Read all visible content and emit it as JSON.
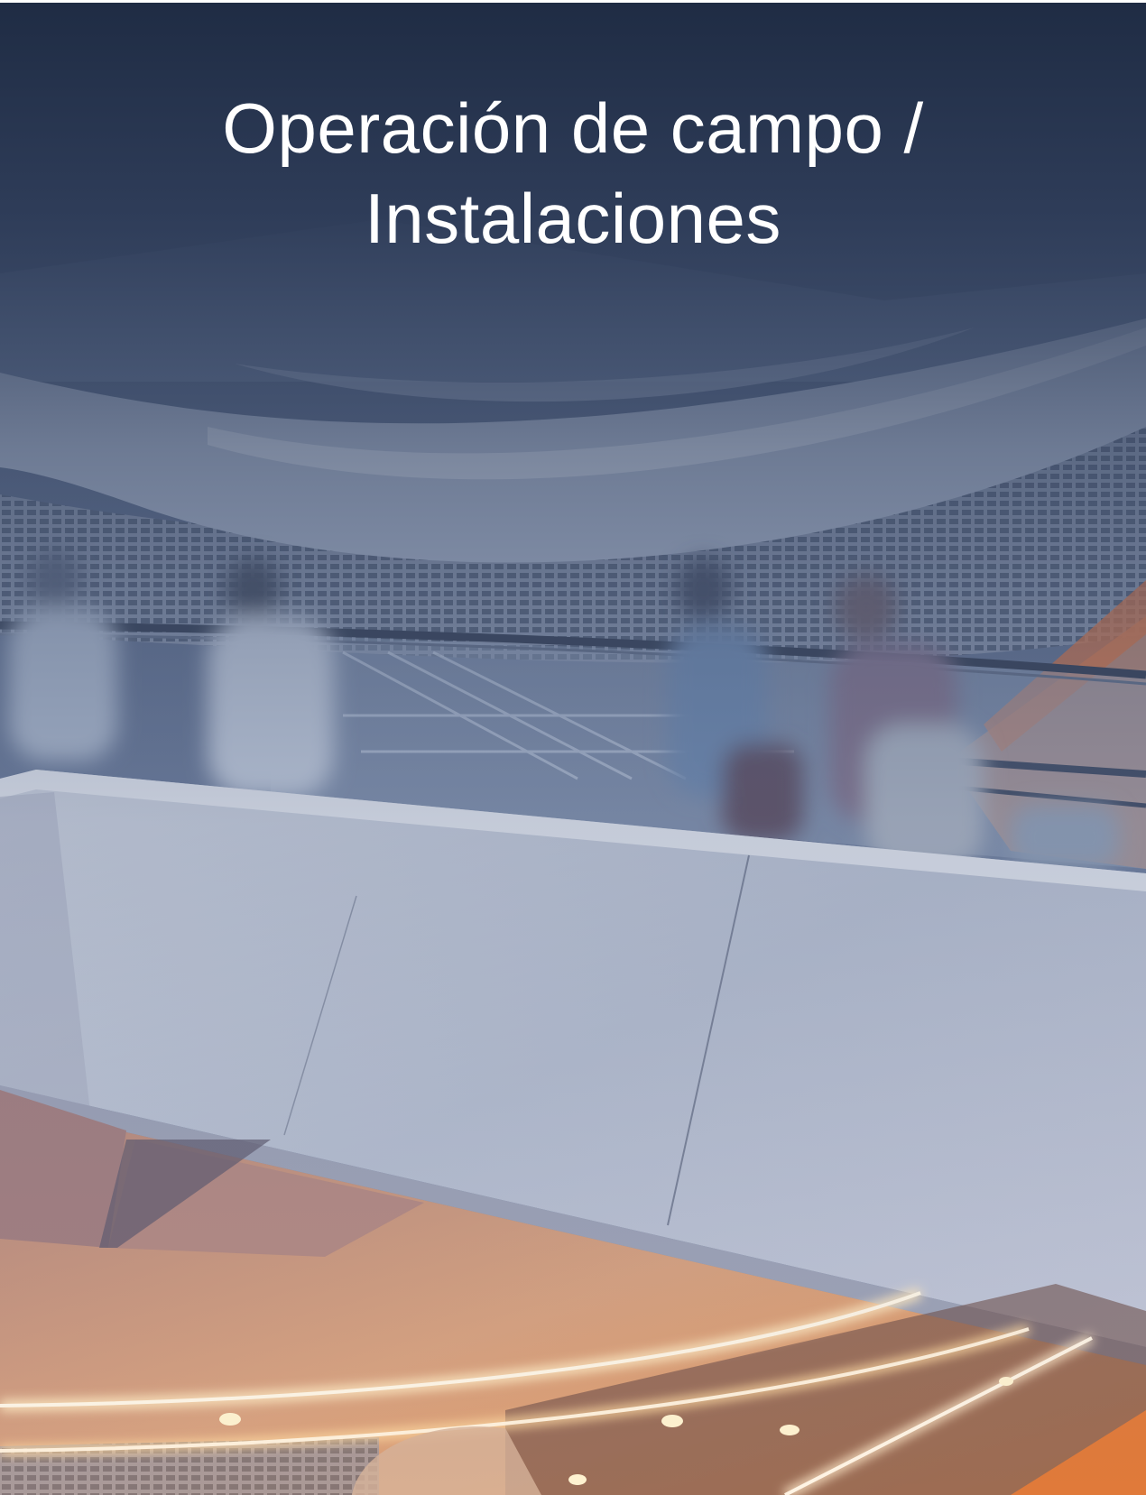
{
  "cover": {
    "title_line_1": "Operación de campo /",
    "title_line_2": "Instalaciones",
    "photo": {
      "subject": "escalator-in-shopping-mall",
      "overlay_color": "#22304a"
    }
  }
}
